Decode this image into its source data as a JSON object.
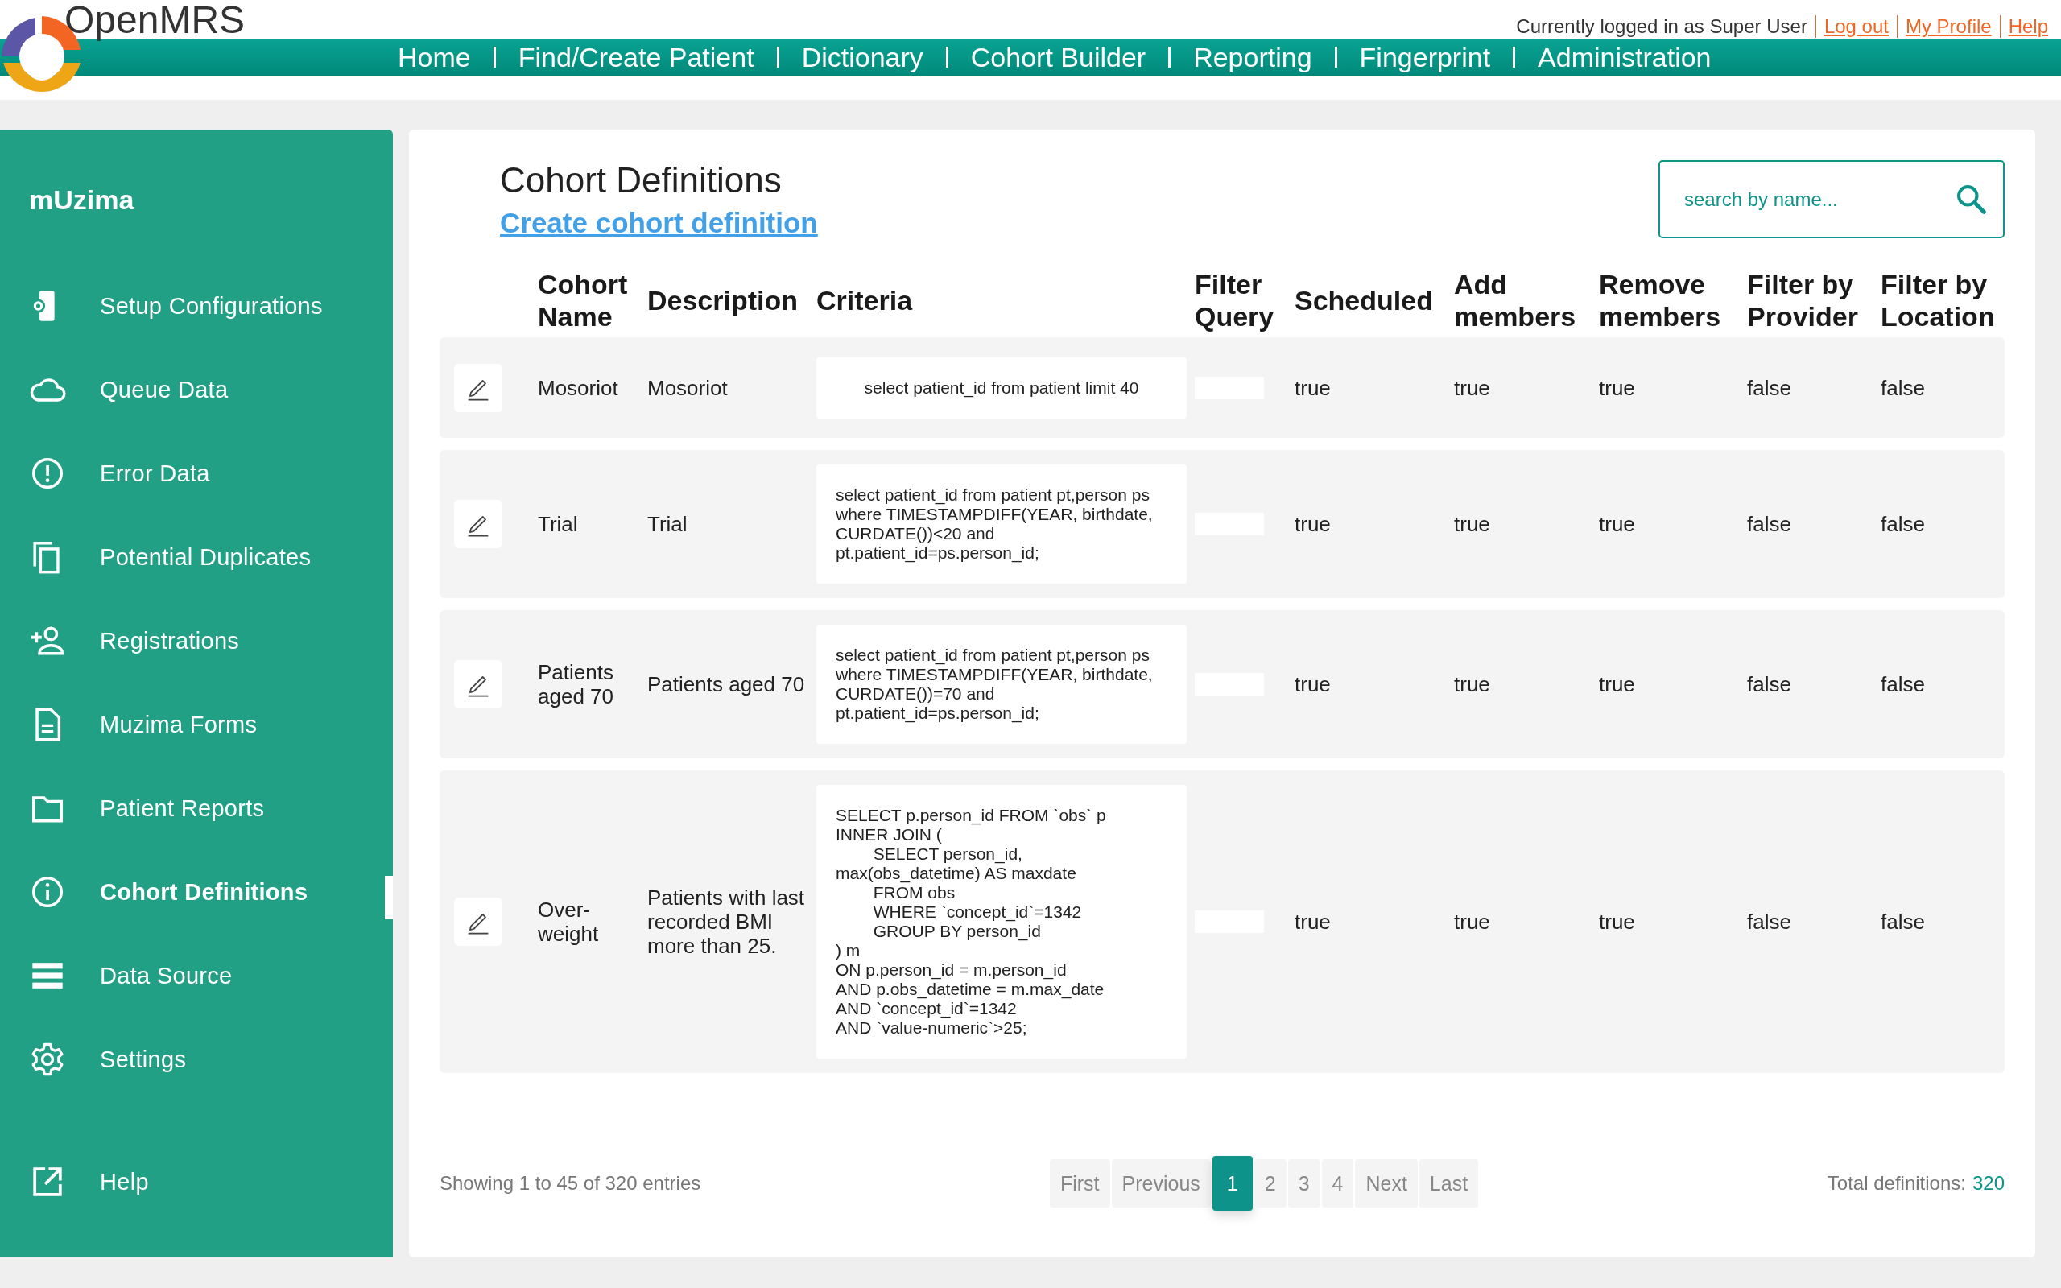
{
  "header": {
    "brand": "OpenMRS",
    "user_text": "Currently logged in as Super User",
    "user_links": [
      "Log out",
      "My Profile",
      "Help"
    ],
    "nav": [
      "Home",
      "Find/Create Patient",
      "Dictionary",
      "Cohort Builder",
      "Reporting",
      "Fingerprint",
      "Administration"
    ]
  },
  "sidebar": {
    "title": "mUzima",
    "items": [
      {
        "label": "Setup Configurations",
        "selected": false
      },
      {
        "label": "Queue Data",
        "selected": false
      },
      {
        "label": "Error Data",
        "selected": false
      },
      {
        "label": "Potential Duplicates",
        "selected": false
      },
      {
        "label": "Registrations",
        "selected": false
      },
      {
        "label": "Muzima Forms",
        "selected": false
      },
      {
        "label": "Patient Reports",
        "selected": false
      },
      {
        "label": "Cohort Definitions",
        "selected": true
      },
      {
        "label": "Data Source",
        "selected": false
      },
      {
        "label": "Settings",
        "selected": false
      }
    ],
    "help": "Help"
  },
  "content": {
    "title": "Cohort Definitions",
    "create_link": "Create cohort definition",
    "search": {
      "placeholder": "search by name..."
    }
  },
  "table": {
    "columns": [
      "Cohort Name",
      "Description",
      "Criteria",
      "Filter Query",
      "Scheduled",
      "Add members",
      "Remove members",
      "Filter by Provider",
      "Filter by Location"
    ],
    "rows": [
      {
        "name": "Mosoriot",
        "description": "Mosoriot",
        "criteria": "select patient_id from patient limit 40",
        "scheduled": "true",
        "add_members": "true",
        "remove_members": "true",
        "filter_by_provider": "false",
        "filter_by_location": "false"
      },
      {
        "name": "Trial",
        "description": "Trial",
        "criteria": "select patient_id from patient pt,person ps where TIMESTAMPDIFF(YEAR, birthdate, CURDATE())<20 and pt.patient_id=ps.person_id;",
        "scheduled": "true",
        "add_members": "true",
        "remove_members": "true",
        "filter_by_provider": "false",
        "filter_by_location": "false"
      },
      {
        "name": "Patients aged 70",
        "description": "Patients aged 70",
        "criteria": "select patient_id from patient pt,person ps where TIMESTAMPDIFF(YEAR, birthdate, CURDATE())=70 and pt.patient_id=ps.person_id;",
        "scheduled": "true",
        "add_members": "true",
        "remove_members": "true",
        "filter_by_provider": "false",
        "filter_by_location": "false"
      },
      {
        "name": "Over-weight",
        "description": "Patients with last recorded BMI more than 25.",
        "criteria": "SELECT p.person_id FROM `obs` p\nINNER JOIN (\n        SELECT person_id,\nmax(obs_datetime) AS maxdate\n        FROM obs\n        WHERE `concept_id`=1342\n        GROUP BY person_id\n) m\nON p.person_id = m.person_id\nAND p.obs_datetime = m.max_date\nAND `concept_id`=1342\nAND `value-numeric`>25;",
        "scheduled": "true",
        "add_members": "true",
        "remove_members": "true",
        "filter_by_provider": "false",
        "filter_by_location": "false"
      }
    ]
  },
  "footer": {
    "showing": "Showing 1 to 45 of 320 entries",
    "pages": [
      {
        "label": "First",
        "selected": false
      },
      {
        "label": "Previous",
        "selected": false
      },
      {
        "label": "1",
        "selected": true
      },
      {
        "label": "2",
        "selected": false
      },
      {
        "label": "3",
        "selected": false
      },
      {
        "label": "4",
        "selected": false
      },
      {
        "label": "Next",
        "selected": false
      },
      {
        "label": "Last",
        "selected": false
      }
    ],
    "total_label": "Total definitions:",
    "total_value": "320"
  }
}
